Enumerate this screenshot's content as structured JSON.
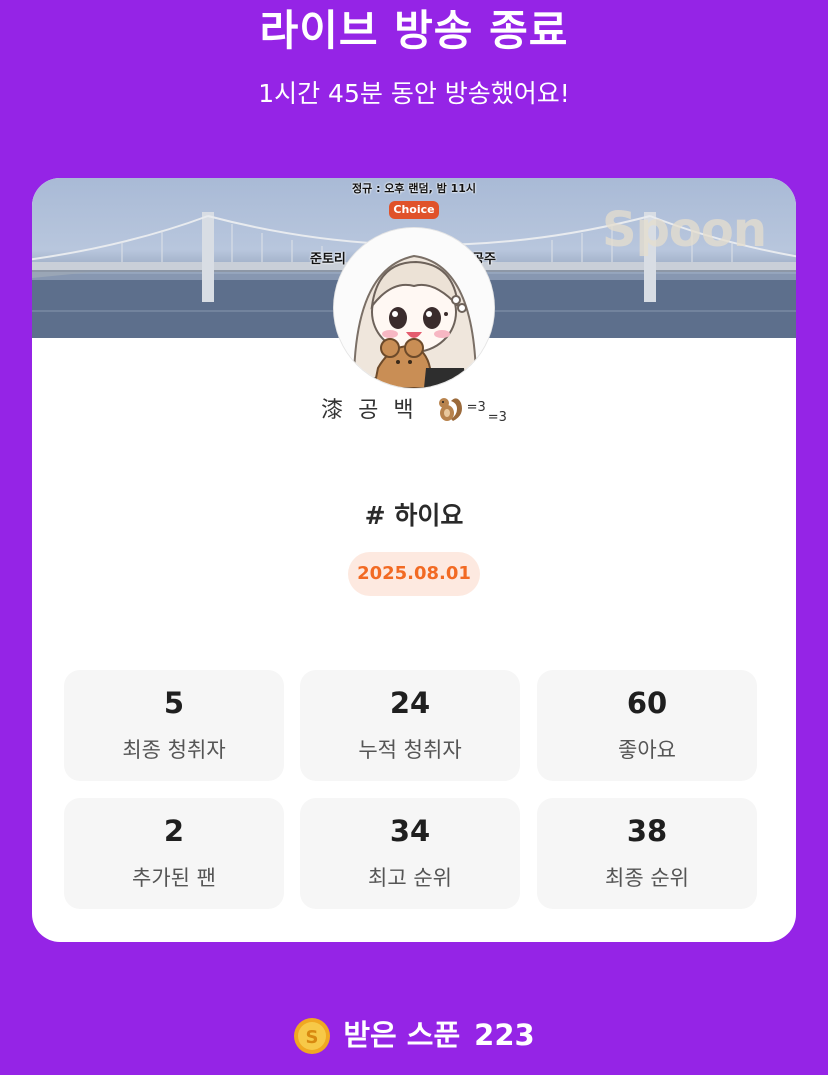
{
  "header": {
    "title": "라이브 방송 종료",
    "subtitle": "1시간 45분 동안 방송했어요!"
  },
  "banner": {
    "caption": "정규 : 오후 랜덤, 밤 11시",
    "choice_badge": "Choice",
    "watermark": "Spoon",
    "left_text": "준토리",
    "right_text": "공주"
  },
  "profile": {
    "nickname": "漆 공 백",
    "nickname_suffix_1": "=3",
    "nickname_suffix_2": "=3",
    "emoji_icon": "squirrel-icon"
  },
  "live": {
    "title": "# 하이요",
    "date": "2025.08.01"
  },
  "stats": [
    {
      "value": "5",
      "label": "최종 청취자"
    },
    {
      "value": "24",
      "label": "누적 청취자"
    },
    {
      "value": "60",
      "label": "좋아요"
    },
    {
      "value": "2",
      "label": "추가된 팬"
    },
    {
      "value": "34",
      "label": "최고 순위"
    },
    {
      "value": "38",
      "label": "최종 순위"
    }
  ],
  "spoons": {
    "label": "받은 스푼",
    "count": "223",
    "icon": "coin-icon"
  },
  "colors": {
    "background": "#9524e6",
    "card": "#ffffff",
    "date_pill_bg": "#fde9e0",
    "date_pill_text": "#f26a23",
    "stat_bg": "#f6f6f6",
    "coin": "#f5b82e"
  }
}
